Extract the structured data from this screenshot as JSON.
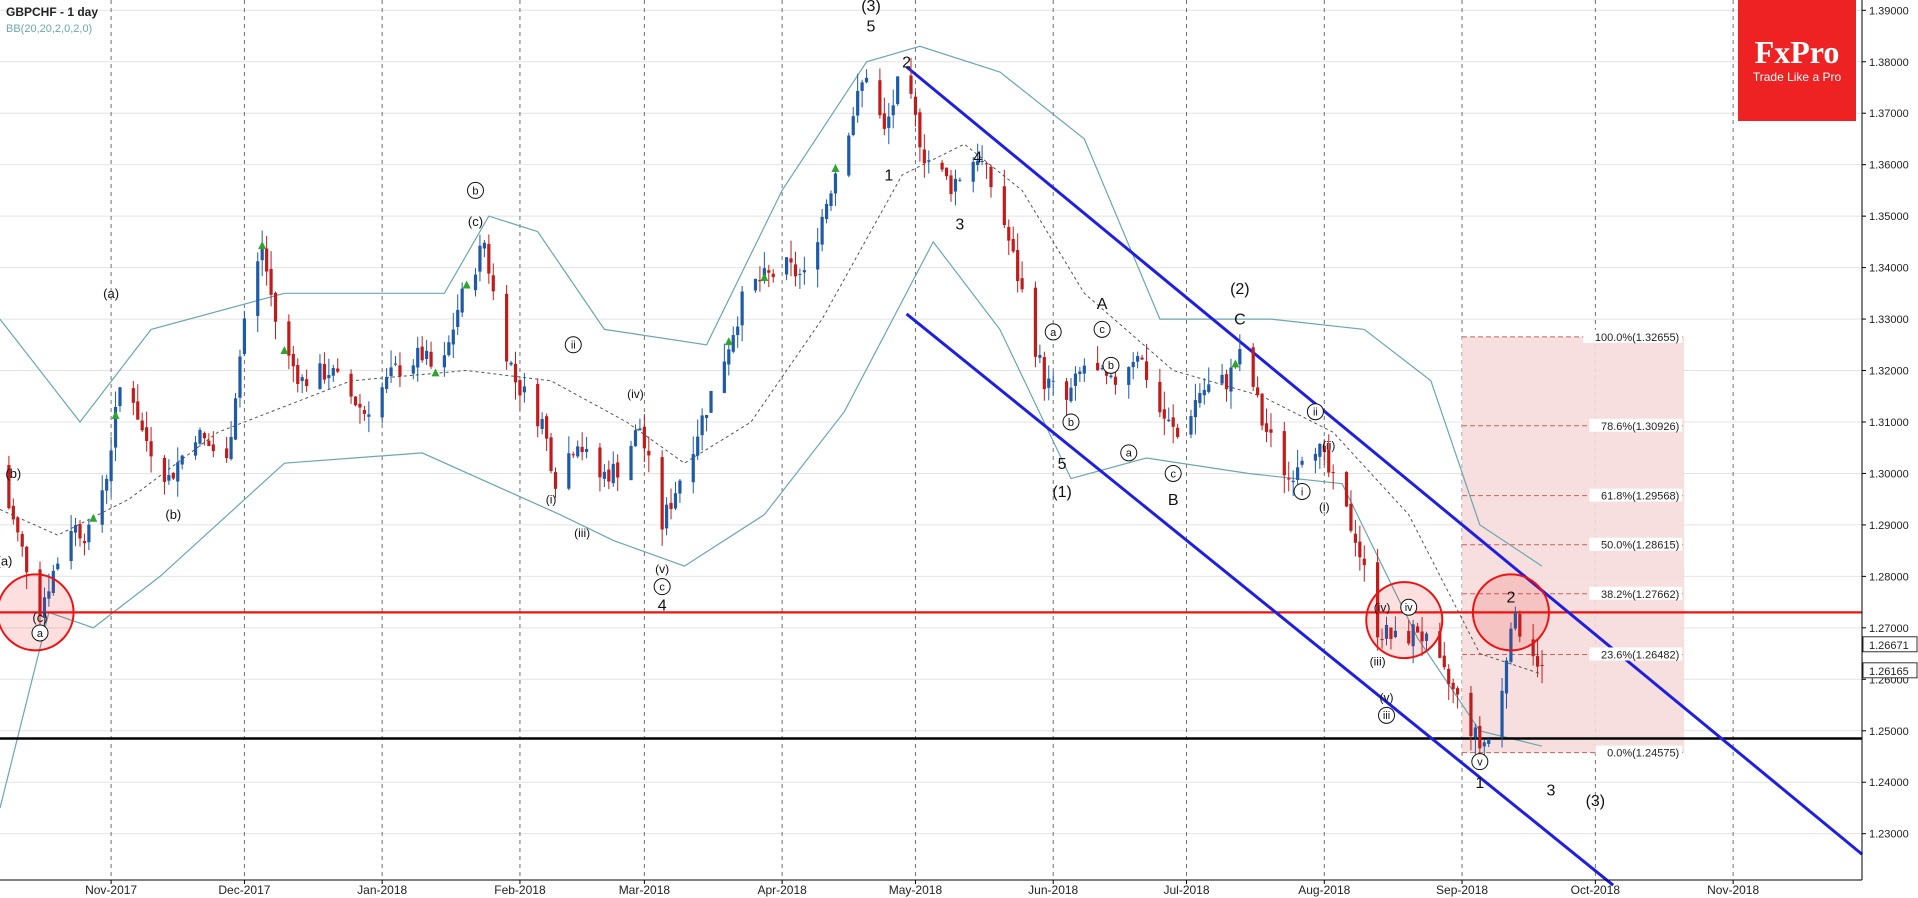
{
  "header": {
    "symbol_title": "GBPCHF - 1 day",
    "indicator": "BB(20,20,2,0,2,0)"
  },
  "logo": {
    "name": "FxPro",
    "tagline": "Trade Like a Pro"
  },
  "colors": {
    "bull": "#1e5aa8",
    "bear": "#c01c1c",
    "channel": "#1f1fe0",
    "resistance": "#ee1111",
    "support": "#000000",
    "bands": "#6aa7b0",
    "fib_zone": "#f6dcdc",
    "fib_line": "#c86060",
    "arrow": "#2ea62e",
    "logo_bg": "#ee2222"
  },
  "chart_data": {
    "type": "candlestick",
    "title": "GBPCHF - 1 day",
    "ylim": [
      1.221,
      1.392
    ],
    "y_ticks": [
      "1.23000",
      "1.24000",
      "1.25000",
      "1.26000",
      "1.27000",
      "1.28000",
      "1.29000",
      "1.30000",
      "1.31000",
      "1.32000",
      "1.33000",
      "1.34000",
      "1.35000",
      "1.36000",
      "1.37000",
      "1.38000",
      "1.39000"
    ],
    "x_labels": [
      "Nov-2017",
      "Dec-2017",
      "Jan-2018",
      "Feb-2018",
      "Mar-2018",
      "Apr-2018",
      "May-2018",
      "Jun-2018",
      "Jul-2018",
      "Aug-2018",
      "Sep-2018",
      "Oct-2018",
      "Nov-2018"
    ],
    "x_range": [
      "2017-10-07",
      "2018-11-30"
    ],
    "price_tags": [
      "1.26671",
      "1.26165"
    ],
    "waypoints": [
      [
        "2017-10-06",
        1.302
      ],
      [
        "2017-10-12",
        1.285
      ],
      [
        "2017-10-16",
        1.274
      ],
      [
        "2017-10-23",
        1.29
      ],
      [
        "2017-10-27",
        1.288
      ],
      [
        "2017-10-31",
        1.3
      ],
      [
        "2017-11-04",
        1.322
      ],
      [
        "2017-11-08",
        1.308
      ],
      [
        "2017-11-14",
        1.299
      ],
      [
        "2017-11-20",
        1.308
      ],
      [
        "2017-11-27",
        1.302
      ],
      [
        "2017-12-01",
        1.33
      ],
      [
        "2017-12-05",
        1.344
      ],
      [
        "2017-12-09",
        1.325
      ],
      [
        "2017-12-14",
        1.318
      ],
      [
        "2017-12-20",
        1.32
      ],
      [
        "2017-12-28",
        1.312
      ],
      [
        "2018-01-04",
        1.32
      ],
      [
        "2018-01-10",
        1.323
      ],
      [
        "2018-01-14",
        1.318
      ],
      [
        "2018-01-18",
        1.332
      ],
      [
        "2018-01-24",
        1.345
      ],
      [
        "2018-01-27",
        1.33
      ],
      [
        "2018-01-31",
        1.318
      ],
      [
        "2018-02-06",
        1.31
      ],
      [
        "2018-02-09",
        1.299
      ],
      [
        "2018-02-14",
        1.307
      ],
      [
        "2018-02-18",
        1.299
      ],
      [
        "2018-02-23",
        1.301
      ],
      [
        "2018-02-28",
        1.309
      ],
      [
        "2018-03-05",
        1.29
      ],
      [
        "2018-03-12",
        1.306
      ],
      [
        "2018-03-18",
        1.32
      ],
      [
        "2018-03-24",
        1.336
      ],
      [
        "2018-04-02",
        1.34
      ],
      [
        "2018-04-06",
        1.338
      ],
      [
        "2018-04-10",
        1.35
      ],
      [
        "2018-04-15",
        1.365
      ],
      [
        "2018-04-20",
        1.378
      ],
      [
        "2018-04-24",
        1.366
      ],
      [
        "2018-04-28",
        1.378
      ],
      [
        "2018-05-03",
        1.362
      ],
      [
        "2018-05-09",
        1.356
      ],
      [
        "2018-05-15",
        1.362
      ],
      [
        "2018-05-20",
        1.352
      ],
      [
        "2018-05-25",
        1.335
      ],
      [
        "2018-05-30",
        1.318
      ],
      [
        "2018-06-04",
        1.314
      ],
      [
        "2018-06-08",
        1.321
      ],
      [
        "2018-06-14",
        1.317
      ],
      [
        "2018-06-20",
        1.324
      ],
      [
        "2018-06-25",
        1.312
      ],
      [
        "2018-06-29",
        1.307
      ],
      [
        "2018-07-04",
        1.316
      ],
      [
        "2018-07-10",
        1.318
      ],
      [
        "2018-07-14",
        1.324
      ],
      [
        "2018-07-18",
        1.31
      ],
      [
        "2018-07-24",
        1.299
      ],
      [
        "2018-07-29",
        1.308
      ],
      [
        "2018-08-03",
        1.298
      ],
      [
        "2018-08-08",
        1.288
      ],
      [
        "2018-08-13",
        1.27
      ],
      [
        "2018-08-18",
        1.267
      ],
      [
        "2018-08-22",
        1.27
      ],
      [
        "2018-08-27",
        1.262
      ],
      [
        "2018-08-31",
        1.256
      ],
      [
        "2018-09-05",
        1.247
      ],
      [
        "2018-09-09",
        1.25
      ],
      [
        "2018-09-12",
        1.272
      ],
      [
        "2018-09-16",
        1.268
      ],
      [
        "2018-09-19",
        1.2617
      ]
    ],
    "bollinger_mid": [
      [
        "2017-10-07",
        1.293
      ],
      [
        "2017-10-20",
        1.288
      ],
      [
        "2017-11-05",
        1.295
      ],
      [
        "2017-11-25",
        1.308
      ],
      [
        "2017-12-25",
        1.318
      ],
      [
        "2018-01-20",
        1.32
      ],
      [
        "2018-02-08",
        1.318
      ],
      [
        "2018-02-25",
        1.31
      ],
      [
        "2018-03-10",
        1.302
      ],
      [
        "2018-03-25",
        1.31
      ],
      [
        "2018-04-10",
        1.33
      ],
      [
        "2018-04-28",
        1.358
      ],
      [
        "2018-05-12",
        1.364
      ],
      [
        "2018-05-25",
        1.355
      ],
      [
        "2018-06-08",
        1.335
      ],
      [
        "2018-06-28",
        1.32
      ],
      [
        "2018-07-18",
        1.315
      ],
      [
        "2018-08-03",
        1.308
      ],
      [
        "2018-08-20",
        1.292
      ],
      [
        "2018-09-05",
        1.265
      ],
      [
        "2018-09-19",
        1.261
      ]
    ],
    "bollinger_upper": [
      [
        "2017-10-07",
        1.33
      ],
      [
        "2017-10-25",
        1.31
      ],
      [
        "2017-11-10",
        1.328
      ],
      [
        "2017-12-10",
        1.335
      ],
      [
        "2018-01-15",
        1.335
      ],
      [
        "2018-01-25",
        1.35
      ],
      [
        "2018-02-05",
        1.347
      ],
      [
        "2018-02-20",
        1.328
      ],
      [
        "2018-03-15",
        1.325
      ],
      [
        "2018-04-01",
        1.355
      ],
      [
        "2018-04-20",
        1.38
      ],
      [
        "2018-05-02",
        1.383
      ],
      [
        "2018-05-20",
        1.378
      ],
      [
        "2018-06-08",
        1.365
      ],
      [
        "2018-06-25",
        1.33
      ],
      [
        "2018-07-20",
        1.33
      ],
      [
        "2018-08-10",
        1.328
      ],
      [
        "2018-08-25",
        1.318
      ],
      [
        "2018-09-05",
        1.29
      ],
      [
        "2018-09-19",
        1.282
      ]
    ],
    "bollinger_lower": [
      [
        "2017-10-07",
        1.235
      ],
      [
        "2017-10-18",
        1.273
      ],
      [
        "2017-10-28",
        1.27
      ],
      [
        "2017-11-12",
        1.28
      ],
      [
        "2017-12-10",
        1.302
      ],
      [
        "2018-01-10",
        1.304
      ],
      [
        "2018-02-10",
        1.292
      ],
      [
        "2018-02-22",
        1.287
      ],
      [
        "2018-03-10",
        1.282
      ],
      [
        "2018-03-28",
        1.292
      ],
      [
        "2018-04-15",
        1.312
      ],
      [
        "2018-05-05",
        1.345
      ],
      [
        "2018-05-20",
        1.328
      ],
      [
        "2018-06-05",
        1.299
      ],
      [
        "2018-06-22",
        1.303
      ],
      [
        "2018-07-15",
        1.3
      ],
      [
        "2018-08-05",
        1.298
      ],
      [
        "2018-08-22",
        1.268
      ],
      [
        "2018-09-05",
        1.25
      ],
      [
        "2018-09-19",
        1.247
      ]
    ],
    "channel_upper": [
      [
        "2018-04-29",
        1.379
      ],
      [
        "2018-11-30",
        1.226
      ]
    ],
    "channel_lower": [
      [
        "2018-04-29",
        1.331
      ],
      [
        "2018-10-05",
        1.22
      ]
    ],
    "resistance_level": 1.273,
    "support_level": 1.2485,
    "fib_zone": {
      "x_start": "2018-09-01",
      "x_end": "2018-10-21",
      "y_top": 1.32655,
      "y_bottom": 1.24575
    },
    "fib_levels": [
      {
        "label": "100.0%(1.32655)",
        "value": 1.32655
      },
      {
        "label": "78.6%(1.30926)",
        "value": 1.30926
      },
      {
        "label": "61.8%(1.29568)",
        "value": 1.29568
      },
      {
        "label": "50.0%(1.28615)",
        "value": 1.28615
      },
      {
        "label": "38.2%(1.27662)",
        "value": 1.27662
      },
      {
        "label": "23.6%(1.26482)",
        "value": 1.26482
      },
      {
        "label": "0.0%(1.24575)",
        "value": 1.24575
      }
    ],
    "circles": [
      {
        "date": "2017-10-15",
        "value": 1.273
      },
      {
        "date": "2018-08-19",
        "value": 1.2715
      },
      {
        "date": "2018-09-12",
        "value": 1.273
      }
    ],
    "labels": [
      {
        "text": "(b)",
        "date": "2017-10-10",
        "value": 1.3,
        "circled": false,
        "size": 13
      },
      {
        "text": "(a)",
        "date": "2017-10-08",
        "value": 1.283,
        "circled": false,
        "size": 13
      },
      {
        "text": "(c)",
        "date": "2017-10-16",
        "value": 1.272,
        "circled": false,
        "size": 13
      },
      {
        "text": "a",
        "date": "2017-10-16",
        "value": 1.269,
        "circled": true,
        "size": 11
      },
      {
        "text": "(a)",
        "date": "2017-11-01",
        "value": 1.335,
        "circled": false,
        "size": 13
      },
      {
        "text": "(b)",
        "date": "2017-11-15",
        "value": 1.292,
        "circled": false,
        "size": 13
      },
      {
        "text": "(c)",
        "date": "2018-01-22",
        "value": 1.349,
        "circled": false,
        "size": 13
      },
      {
        "text": "b",
        "date": "2018-01-22",
        "value": 1.355,
        "circled": true,
        "size": 11
      },
      {
        "text": "ii",
        "date": "2018-02-13",
        "value": 1.325,
        "circled": true,
        "size": 11
      },
      {
        "text": "(i)",
        "date": "2018-02-08",
        "value": 1.295,
        "circled": false,
        "size": 12
      },
      {
        "text": "(iii)",
        "date": "2018-02-15",
        "value": 1.2885,
        "circled": false,
        "size": 12
      },
      {
        "text": "(iv)",
        "date": "2018-02-27",
        "value": 1.3155,
        "circled": false,
        "size": 12
      },
      {
        "text": "(v)",
        "date": "2018-03-05",
        "value": 1.2815,
        "circled": false,
        "size": 12
      },
      {
        "text": "c",
        "date": "2018-03-05",
        "value": 1.278,
        "circled": true,
        "size": 11
      },
      {
        "text": "4",
        "date": "2018-03-05",
        "value": 1.2745,
        "circled": false,
        "size": 16
      },
      {
        "text": "(3)",
        "date": "2018-04-21",
        "value": 1.391,
        "circled": false,
        "size": 16
      },
      {
        "text": "5",
        "date": "2018-04-21",
        "value": 1.387,
        "circled": false,
        "size": 16
      },
      {
        "text": "1",
        "date": "2018-04-25",
        "value": 1.358,
        "circled": false,
        "size": 16
      },
      {
        "text": "2",
        "date": "2018-04-29",
        "value": 1.38,
        "circled": false,
        "size": 16
      },
      {
        "text": "3",
        "date": "2018-05-11",
        "value": 1.3485,
        "circled": false,
        "size": 16
      },
      {
        "text": "4",
        "date": "2018-05-15",
        "value": 1.3615,
        "circled": false,
        "size": 16
      },
      {
        "text": "5",
        "date": "2018-06-03",
        "value": 1.302,
        "circled": false,
        "size": 16
      },
      {
        "text": "(1)",
        "date": "2018-06-03",
        "value": 1.2965,
        "circled": false,
        "size": 16
      },
      {
        "text": "a",
        "date": "2018-06-01",
        "value": 1.3275,
        "circled": true,
        "size": 11
      },
      {
        "text": "b",
        "date": "2018-06-05",
        "value": 1.31,
        "circled": true,
        "size": 11
      },
      {
        "text": "A",
        "date": "2018-06-12",
        "value": 1.333,
        "circled": false,
        "size": 16
      },
      {
        "text": "c",
        "date": "2018-06-12",
        "value": 1.328,
        "circled": true,
        "size": 11
      },
      {
        "text": "b",
        "date": "2018-06-14",
        "value": 1.321,
        "circled": true,
        "size": 11
      },
      {
        "text": "a",
        "date": "2018-06-18",
        "value": 1.304,
        "circled": true,
        "size": 11
      },
      {
        "text": "c",
        "date": "2018-06-28",
        "value": 1.3,
        "circled": true,
        "size": 11
      },
      {
        "text": "B",
        "date": "2018-06-28",
        "value": 1.295,
        "circled": false,
        "size": 16
      },
      {
        "text": "(2)",
        "date": "2018-07-13",
        "value": 1.336,
        "circled": false,
        "size": 16
      },
      {
        "text": "C",
        "date": "2018-07-13",
        "value": 1.33,
        "circled": false,
        "size": 16
      },
      {
        "text": "ii",
        "date": "2018-07-30",
        "value": 1.312,
        "circled": true,
        "size": 11
      },
      {
        "text": "(ii)",
        "date": "2018-08-02",
        "value": 1.3055,
        "circled": false,
        "size": 12
      },
      {
        "text": "i",
        "date": "2018-07-27",
        "value": 1.2965,
        "circled": true,
        "size": 11
      },
      {
        "text": "(i)",
        "date": "2018-08-01",
        "value": 1.2935,
        "circled": false,
        "size": 12
      },
      {
        "text": "(iv)",
        "date": "2018-08-14",
        "value": 1.274,
        "circled": false,
        "size": 12
      },
      {
        "text": "iv",
        "date": "2018-08-20",
        "value": 1.274,
        "circled": true,
        "size": 11
      },
      {
        "text": "(iii)",
        "date": "2018-08-13",
        "value": 1.2635,
        "circled": false,
        "size": 12
      },
      {
        "text": "(v)",
        "date": "2018-08-15",
        "value": 1.2565,
        "circled": false,
        "size": 12
      },
      {
        "text": "iii",
        "date": "2018-08-15",
        "value": 1.253,
        "circled": true,
        "size": 11
      },
      {
        "text": "2",
        "date": "2018-09-12",
        "value": 1.276,
        "circled": false,
        "size": 16
      },
      {
        "text": "v",
        "date": "2018-09-05",
        "value": 1.244,
        "circled": true,
        "size": 11
      },
      {
        "text": "1",
        "date": "2018-09-05",
        "value": 1.24,
        "circled": false,
        "size": 16
      },
      {
        "text": "3",
        "date": "2018-09-21",
        "value": 1.2385,
        "circled": false,
        "size": 16
      },
      {
        "text": "(3)",
        "date": "2018-10-01",
        "value": 1.2365,
        "circled": false,
        "size": 16
      }
    ],
    "arrows": [
      "2017-10-28",
      "2017-11-02",
      "2017-12-05",
      "2017-12-10",
      "2018-01-13",
      "2018-01-20",
      "2018-03-20",
      "2018-03-28",
      "2018-04-13",
      "2018-07-12"
    ],
    "grid": true,
    "legend": "none"
  }
}
